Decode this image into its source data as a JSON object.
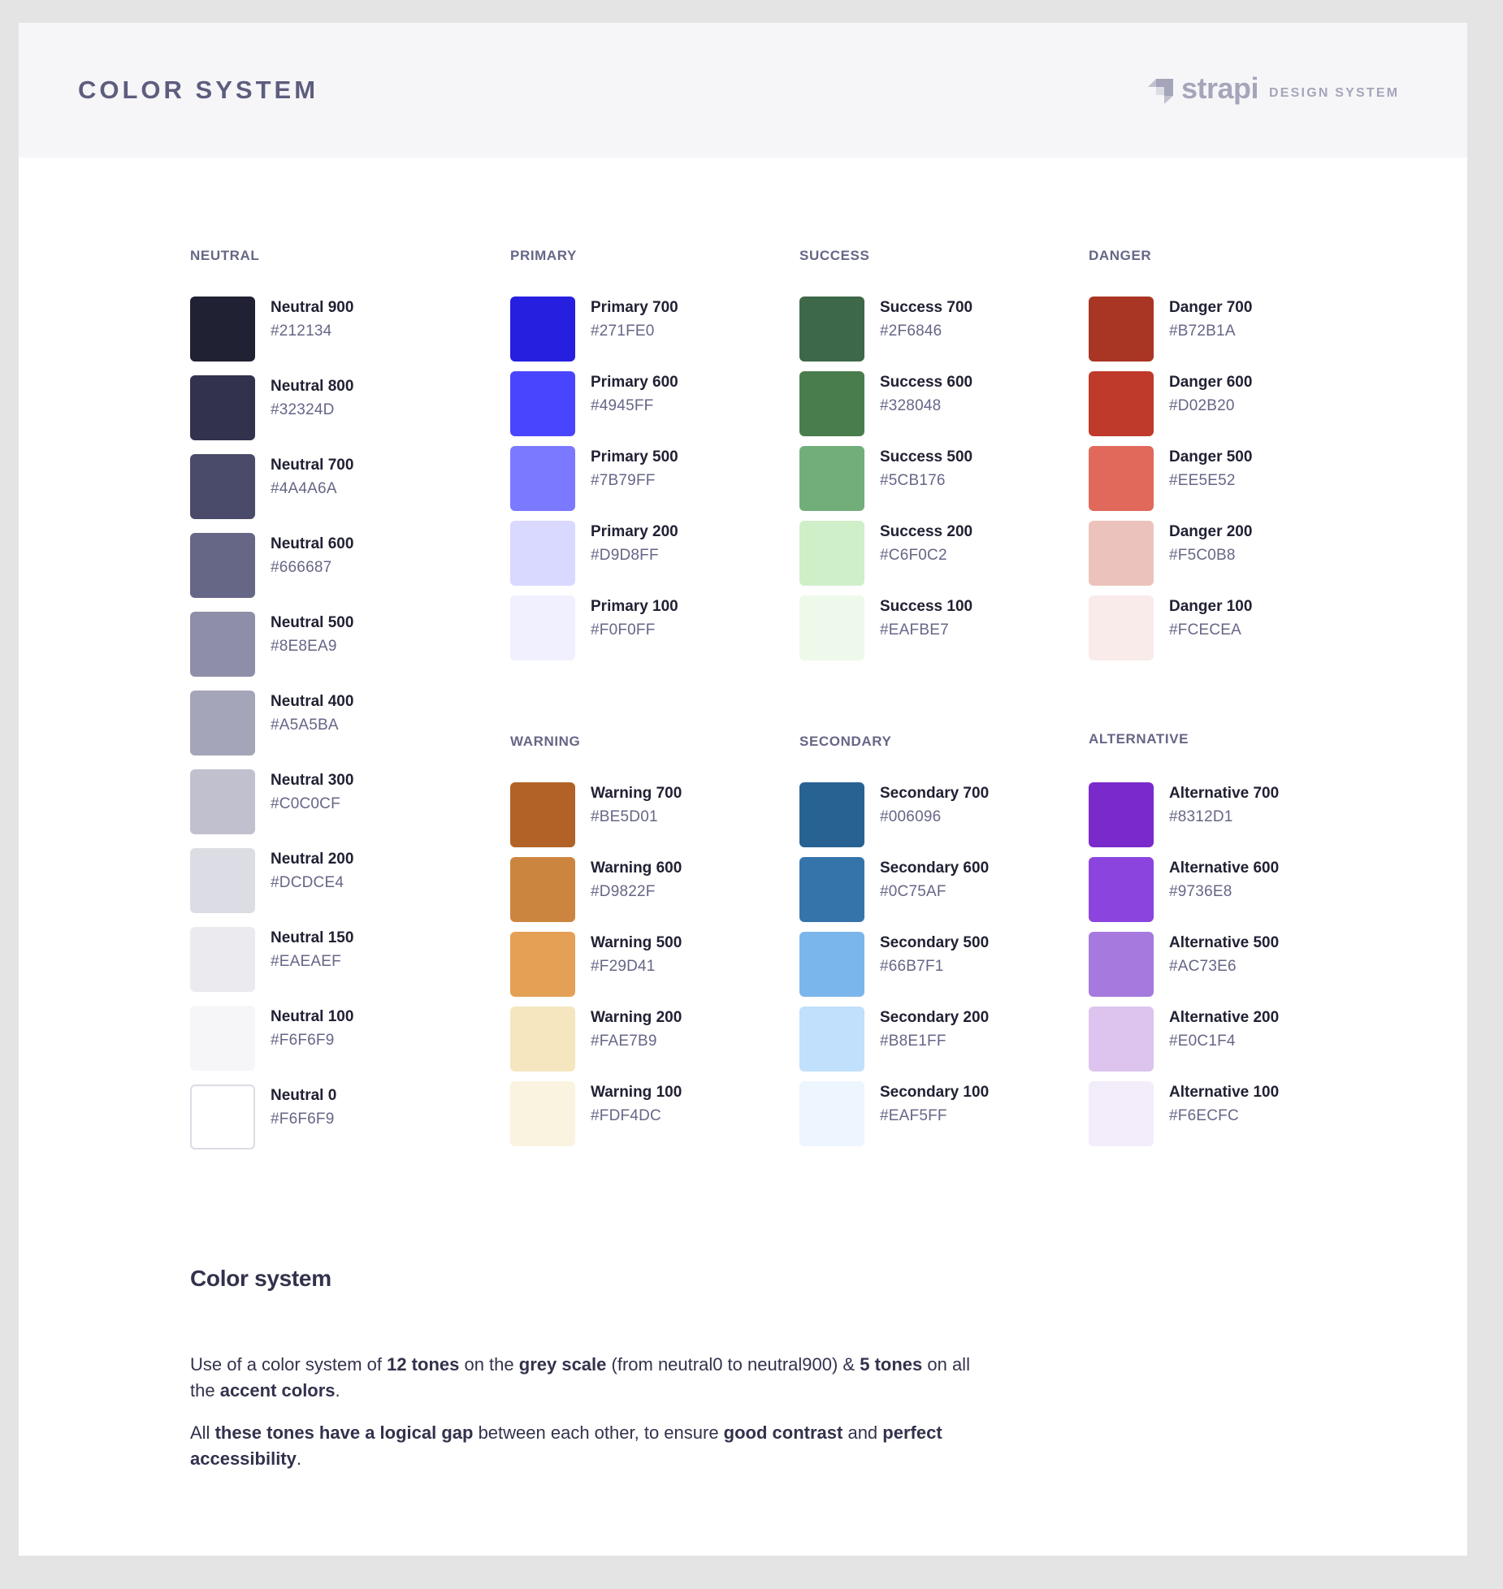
{
  "header": {
    "title": "COLOR SYSTEM",
    "brand_icon": "strapi-logo-icon",
    "brand_name": "strapi",
    "brand_sub": "DESIGN SYSTEM"
  },
  "groups": {
    "neutral": {
      "label": "NEUTRAL",
      "swatches": [
        {
          "name": "Neutral 900",
          "hex": "#212134",
          "fill": "#212134"
        },
        {
          "name": "Neutral 800",
          "hex": "#32324D",
          "fill": "#32324D"
        },
        {
          "name": "Neutral 700",
          "hex": "#4A4A6A",
          "fill": "#4A4A6A"
        },
        {
          "name": "Neutral 600",
          "hex": "#666687",
          "fill": "#666687"
        },
        {
          "name": "Neutral 500",
          "hex": "#8E8EA9",
          "fill": "#8E8EA9"
        },
        {
          "name": "Neutral 400",
          "hex": "#A5A5BA",
          "fill": "#A5A5BA"
        },
        {
          "name": "Neutral 300",
          "hex": "#C0C0CF",
          "fill": "#C0C0CF"
        },
        {
          "name": "Neutral 200",
          "hex": "#DCDCE4",
          "fill": "#DCDCE4"
        },
        {
          "name": "Neutral 150",
          "hex": "#EAEAEF",
          "fill": "#EAEAEF"
        },
        {
          "name": "Neutral 100",
          "hex": "#F6F6F9",
          "fill": "#F6F6F9"
        },
        {
          "name": "Neutral 0",
          "hex": "#F6F6F9",
          "fill": "#FFFFFF"
        }
      ]
    },
    "primary": {
      "label": "PRIMARY",
      "swatches": [
        {
          "name": "Primary 700",
          "hex": "#271FE0",
          "fill": "#271FE0"
        },
        {
          "name": "Primary 600",
          "hex": "#4945FF",
          "fill": "#4945FF"
        },
        {
          "name": "Primary 500",
          "hex": "#7B79FF",
          "fill": "#7B79FF"
        },
        {
          "name": "Primary 200",
          "hex": "#D9D8FF",
          "fill": "#D9D8FF"
        },
        {
          "name": "Primary 100",
          "hex": "#F0F0FF",
          "fill": "#F0F0FF"
        }
      ]
    },
    "success": {
      "label": "SUCCESS",
      "swatches": [
        {
          "name": "Success 700",
          "hex": "#2F6846",
          "fill": "#3D6849"
        },
        {
          "name": "Success 600",
          "hex": "#328048",
          "fill": "#4A7D4D"
        },
        {
          "name": "Success 500",
          "hex": "#5CB176",
          "fill": "#72AE7A"
        },
        {
          "name": "Success 200",
          "hex": "#C6F0C2",
          "fill": "#CFEFC8"
        },
        {
          "name": "Success 100",
          "hex": "#EAFBE7",
          "fill": "#EDF9EA"
        }
      ]
    },
    "danger": {
      "label": "DANGER",
      "swatches": [
        {
          "name": "Danger 700",
          "hex": "#B72B1A",
          "fill": "#A93524"
        },
        {
          "name": "Danger 600",
          "hex": "#D02B20",
          "fill": "#C03A2B"
        },
        {
          "name": "Danger 500",
          "hex": "#EE5E52",
          "fill": "#E0695B"
        },
        {
          "name": "Danger 200",
          "hex": "#F5C0B8",
          "fill": "#ECC3BC"
        },
        {
          "name": "Danger 100",
          "hex": "#FCECEA",
          "fill": "#F9EBEA"
        }
      ]
    },
    "warning": {
      "label": "WARNING",
      "swatches": [
        {
          "name": "Warning 700",
          "hex": "#BE5D01",
          "fill": "#B26226"
        },
        {
          "name": "Warning 600",
          "hex": "#D9822F",
          "fill": "#CC853F"
        },
        {
          "name": "Warning 500",
          "hex": "#F29D41",
          "fill": "#E4A055"
        },
        {
          "name": "Warning 200",
          "hex": "#FAE7B9",
          "fill": "#F5E6C0"
        },
        {
          "name": "Warning 100",
          "hex": "#FDF4DC",
          "fill": "#FAF3DF"
        }
      ]
    },
    "secondary": {
      "label": "SECONDARY",
      "swatches": [
        {
          "name": "Secondary 700",
          "hex": "#006096",
          "fill": "#276293"
        },
        {
          "name": "Secondary 600",
          "hex": "#0C75AF",
          "fill": "#3474AB"
        },
        {
          "name": "Secondary 500",
          "hex": "#66B7F1",
          "fill": "#7AB6EB"
        },
        {
          "name": "Secondary 200",
          "hex": "#B8E1FF",
          "fill": "#C1E0FB"
        },
        {
          "name": "Secondary 100",
          "hex": "#EAF5FF",
          "fill": "#EDF5FE"
        }
      ]
    },
    "alternative": {
      "label": "ALTERNATIVE",
      "swatches": [
        {
          "name": "Alternative 700",
          "hex": "#8312D1",
          "fill": "#7A2ACB"
        },
        {
          "name": "Alternative 600",
          "hex": "#9736E8",
          "fill": "#8C44DF"
        },
        {
          "name": "Alternative 500",
          "hex": "#AC73E6",
          "fill": "#A679DE"
        },
        {
          "name": "Alternative 200",
          "hex": "#E0C1F4",
          "fill": "#DCC4EE"
        },
        {
          "name": "Alternative 100",
          "hex": "#F6ECFC",
          "fill": "#F3ECFA"
        }
      ]
    }
  },
  "description": {
    "title": "Color system",
    "p1": [
      {
        "t": "Use of a color system of ",
        "b": false
      },
      {
        "t": "12 tones",
        "b": true
      },
      {
        "t": " on the ",
        "b": false
      },
      {
        "t": "grey scale",
        "b": true
      },
      {
        "t": " (from neutral0 to neutral900) & ",
        "b": false
      },
      {
        "t": "5 tones",
        "b": true
      },
      {
        "t": " on all the ",
        "b": false
      },
      {
        "t": "accent colors",
        "b": true
      },
      {
        "t": ".",
        "b": false
      }
    ],
    "p2": [
      {
        "t": "All ",
        "b": false
      },
      {
        "t": "these tones have a logical gap",
        "b": true
      },
      {
        "t": " between each other, to ensure ",
        "b": false
      },
      {
        "t": "good contrast",
        "b": true
      },
      {
        "t": " and ",
        "b": false
      },
      {
        "t": "perfect accessibility",
        "b": true
      },
      {
        "t": ".",
        "b": false
      }
    ]
  }
}
